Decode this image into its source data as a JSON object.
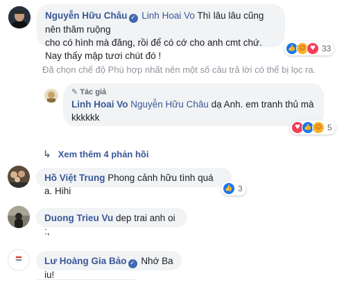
{
  "comment1": {
    "author": "Nguyễn Hữu Châu",
    "verified": true,
    "tag": "Linh Hoai Vo",
    "line1": "Thì lâu lâu cũng nên thăm ruộng",
    "line2": "cho có hình mà đăng, rồi để có cớ cho anh cmt chứ.",
    "line3": "Nay thấy mập tươi chút đó !",
    "reaction_count": "33",
    "reaction_icons": [
      "like-icon",
      "care-icon",
      "love-icon"
    ]
  },
  "filter_note": "Đã chọn chế độ Phù hợp nhất nên một số câu trả lời có thể bị lọc ra.",
  "reply1": {
    "badge": "Tác giả",
    "author": "Linh Hoai Vo",
    "tag": "Nguyễn Hữu Châu",
    "line1": "dạ Anh. em tranh thủ mà",
    "line2": "kkkkkk",
    "reaction_count": "5",
    "reaction_icons": [
      "love-icon",
      "like-icon",
      "care-icon"
    ]
  },
  "more_replies": "Xem thêm 4 phản hồi",
  "comment2": {
    "author": "Hồ Việt Trung",
    "text": "Phong cảnh hữu tình quá a. Hihi",
    "reaction_count": "3",
    "reaction_icons": [
      "like-icon"
    ]
  },
  "comment3": {
    "author": "Duong Trieu Vu",
    "text": "dep trai anh oi :,"
  },
  "comment4": {
    "author": "Lư Hoàng Gia Bảo",
    "verified": true,
    "text": "Nhớ Ba iu!"
  },
  "colors": {
    "link": "#385898",
    "bubble": "#f2f3f5",
    "muted": "#90949c",
    "like": "#1877f2",
    "love": "#f33e58"
  }
}
